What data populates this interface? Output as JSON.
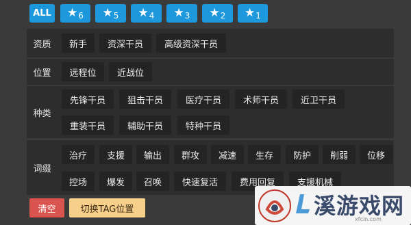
{
  "star_filters": {
    "all_label": "ALL",
    "buttons": [
      {
        "star": "★",
        "num": "6"
      },
      {
        "star": "★",
        "num": "5"
      },
      {
        "star": "★",
        "num": "4"
      },
      {
        "star": "★",
        "num": "3"
      },
      {
        "star": "★",
        "num": "2"
      },
      {
        "star": "★",
        "num": "1"
      }
    ]
  },
  "qualification": {
    "label": "资质",
    "tags": [
      "新手",
      "资深干员",
      "高级资深干员"
    ]
  },
  "position": {
    "label": "位置",
    "tags": [
      "远程位",
      "近战位"
    ]
  },
  "class": {
    "label": "种类",
    "tags": [
      "先锋干员",
      "狙击干员",
      "医疗干员",
      "术师干员",
      "近卫干员",
      "重装干员",
      "辅助干员",
      "特种干员"
    ]
  },
  "affix": {
    "label": "词缀",
    "tags": [
      "治疗",
      "支援",
      "输出",
      "群攻",
      "减速",
      "生存",
      "防护",
      "削弱",
      "位移",
      "控场",
      "爆发",
      "召唤",
      "快速复活",
      "费用回复",
      "支援机械"
    ]
  },
  "actions": {
    "clear_label": "清空",
    "switch_label": "切换TAG位置"
  },
  "watermark": {
    "brand": "溪游戏网",
    "url": "xfcin.com"
  },
  "colors": {
    "star_button": "#1e98dc",
    "clear_button": "#d9534f",
    "switch_button": "#f6cf8a",
    "panel": "#2d2d2d",
    "tag": "#242424"
  }
}
